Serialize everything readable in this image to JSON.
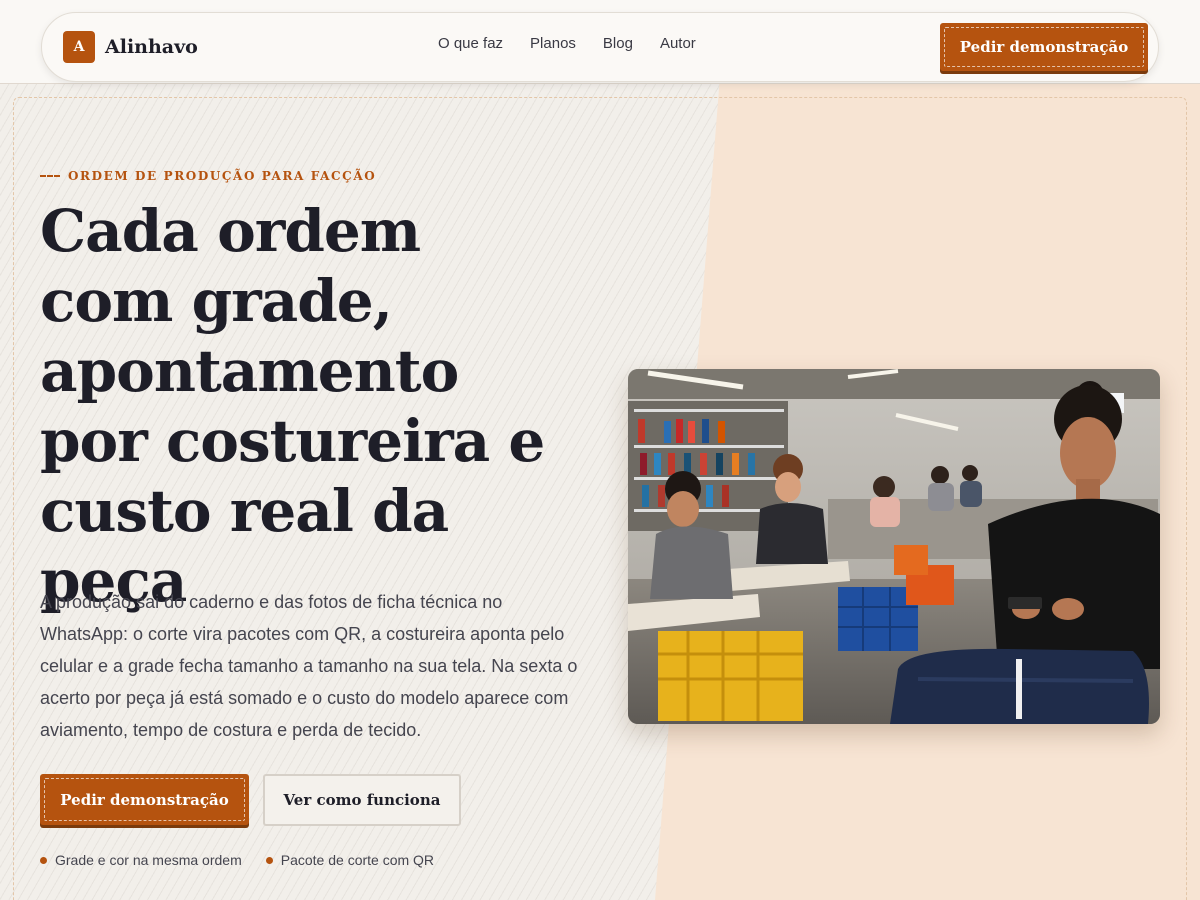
{
  "brand": {
    "mark": "A",
    "name": "Alinhavo"
  },
  "nav": {
    "links": [
      "O que faz",
      "Planos",
      "Blog",
      "Autor"
    ],
    "cta": "Pedir demonstração"
  },
  "hero": {
    "eyebrow": "ORDEM DE PRODUÇÃO PARA FACÇÃO",
    "headline_lines": [
      "Cada ordem",
      "com grade,",
      "apontamento",
      "por costureira e",
      "custo real da peça"
    ],
    "lead": "A produção sai do caderno e das fotos de ficha técnica no WhatsApp: o corte vira pacotes com QR, a costureira aponta pelo celular e a grade fecha tamanho a tamanho na sua tela. Na sexta o acerto por peça já está somado e o custo do modelo aparece com aviamento, tempo de costura e perda de tecido.",
    "primary_cta": "Pedir demonstração",
    "secondary_cta": "Ver como funciona",
    "features": [
      "Grade e cor na mesma ordem",
      "Pacote de corte com QR"
    ]
  },
  "colors": {
    "accent": "#b5530f",
    "ink": "#1e1e28",
    "peach": "#f7e4d3",
    "paper": "#f2efea"
  },
  "photo": {
    "icon": "garment-workshop-photo"
  }
}
